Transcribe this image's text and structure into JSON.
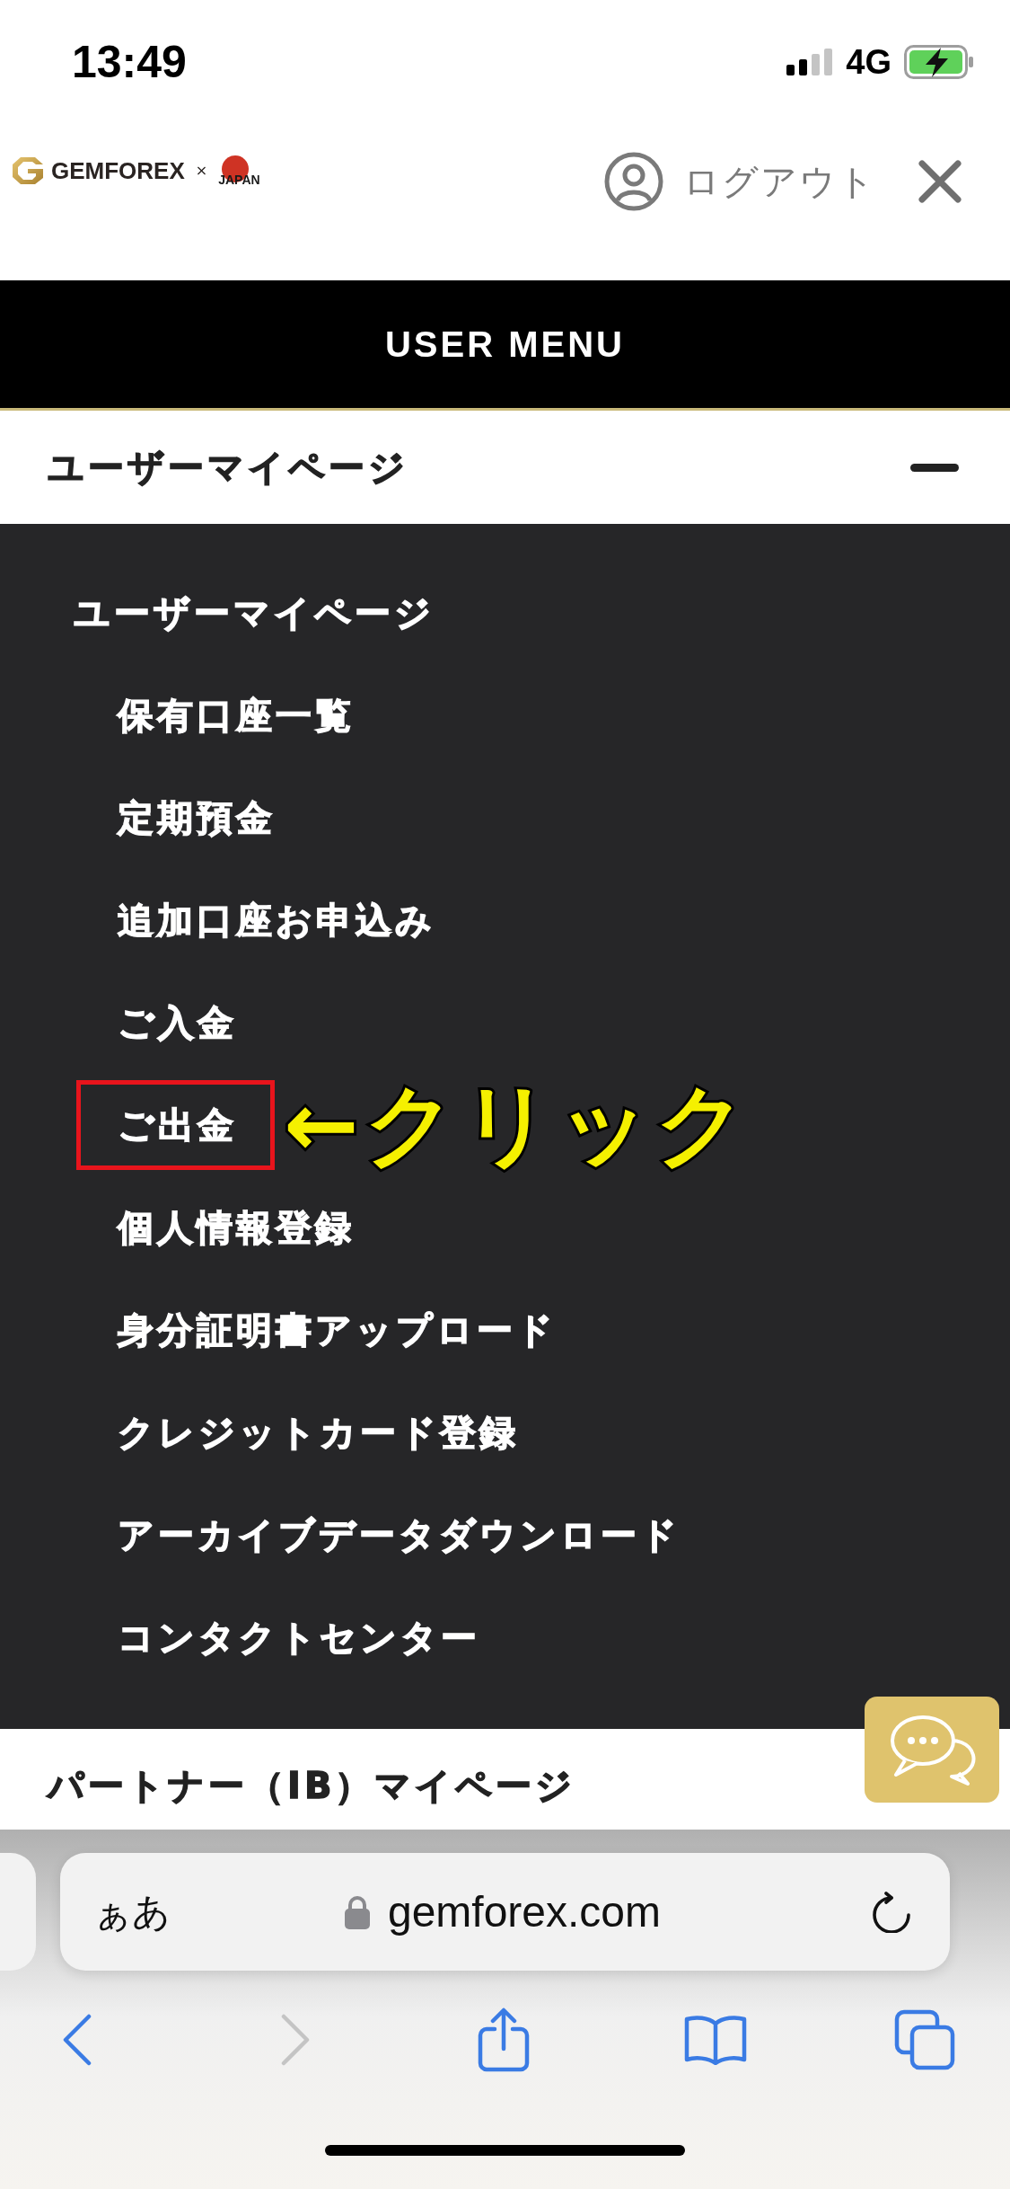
{
  "status_bar": {
    "time": "13:49",
    "network": "4G"
  },
  "header": {
    "logo": {
      "brand": "GEMFOREX",
      "separator": "×",
      "partner": "JAPAN"
    },
    "logout": {
      "label": "ログアウト"
    }
  },
  "menu": {
    "title": "USER MENU",
    "sections": [
      {
        "label": "ユーザーマイページ",
        "expanded": true,
        "heading": "ユーザーマイページ",
        "items": [
          {
            "label": "保有口座一覧",
            "highlighted": false
          },
          {
            "label": "定期預金",
            "highlighted": false
          },
          {
            "label": "追加口座お申込み",
            "highlighted": false
          },
          {
            "label": "ご入金",
            "highlighted": false
          },
          {
            "label": "ご出金",
            "highlighted": true,
            "callout": "←クリック"
          },
          {
            "label": "個人情報登録",
            "highlighted": false
          },
          {
            "label": "身分証明書アップロード",
            "highlighted": false
          },
          {
            "label": "クレジットカード登録",
            "highlighted": false
          },
          {
            "label": "アーカイブデータダウンロード",
            "highlighted": false
          },
          {
            "label": "コンタクトセンター",
            "highlighted": false
          }
        ]
      },
      {
        "label": "パートナー（IB）マイページ",
        "expanded": false
      }
    ]
  },
  "browser": {
    "text_size_button": "ぁあ",
    "url": "gemforex.com",
    "toolbar": {
      "back_disabled": false,
      "forward_disabled": true
    }
  }
}
